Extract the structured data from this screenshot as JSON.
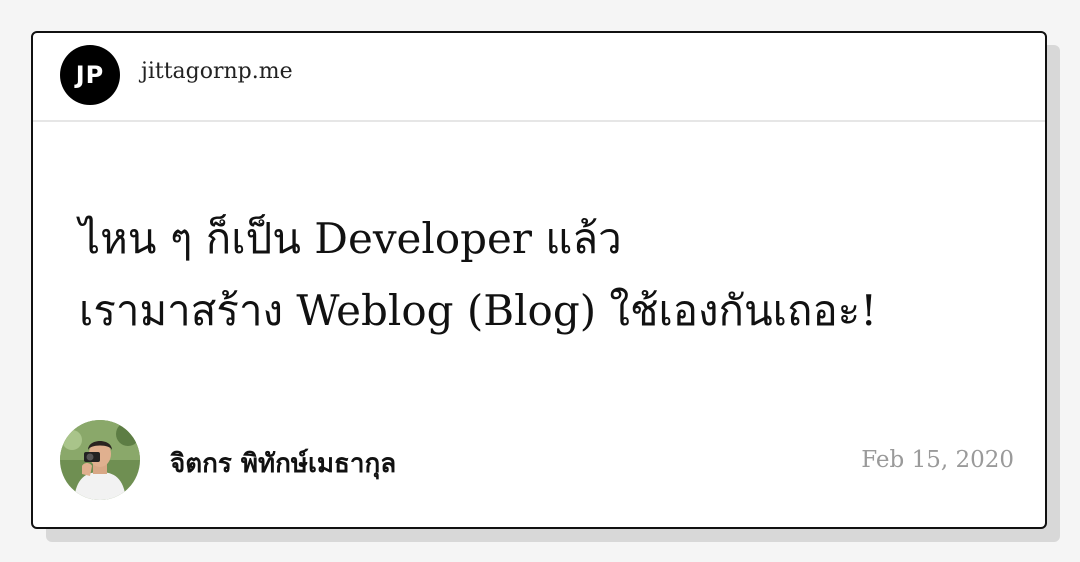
{
  "header": {
    "logo_text": "JP",
    "site_name": "jittagornp.me"
  },
  "post": {
    "title_line1": "ไหน ๆ ก็เป็น Developer แล้ว",
    "title_line2": "เรามาสร้าง Weblog (Blog) ใช้เองกันเถอะ!"
  },
  "author": {
    "name": "จิตกร พิทักษ์เมธากุล",
    "avatar_icon": "author-photo"
  },
  "meta": {
    "date": "Feb 15, 2020"
  }
}
